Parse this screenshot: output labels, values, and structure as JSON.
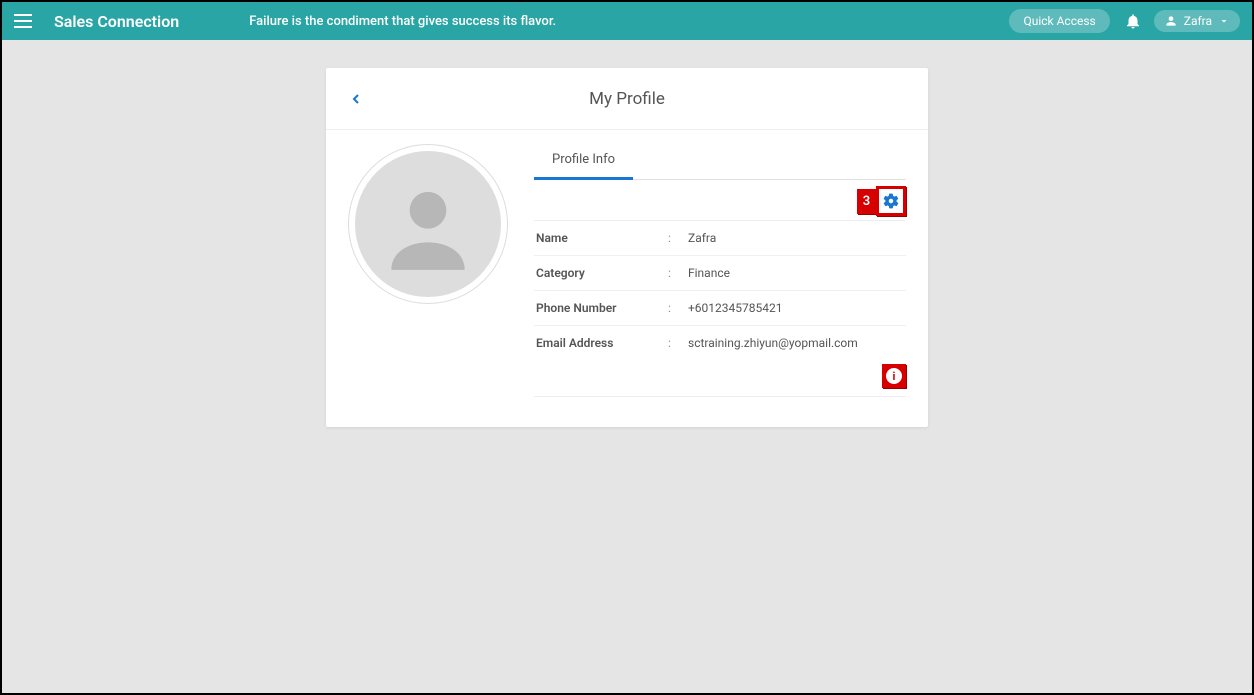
{
  "header": {
    "brand": "Sales Connection",
    "quote": "Failure is the condiment that gives success its flavor.",
    "quick_access": "Quick Access",
    "user_name": "Zafra"
  },
  "card": {
    "title": "My Profile",
    "tab_label": "Profile Info",
    "step_number": "3",
    "info_icon_text": "i"
  },
  "profile": {
    "name_label": "Name",
    "name_value": "Zafra",
    "category_label": "Category",
    "category_value": "Finance",
    "phone_label": "Phone Number",
    "phone_value": "+6012345785421",
    "email_label": "Email Address",
    "email_value": "sctraining.zhiyun@yopmail.com"
  }
}
